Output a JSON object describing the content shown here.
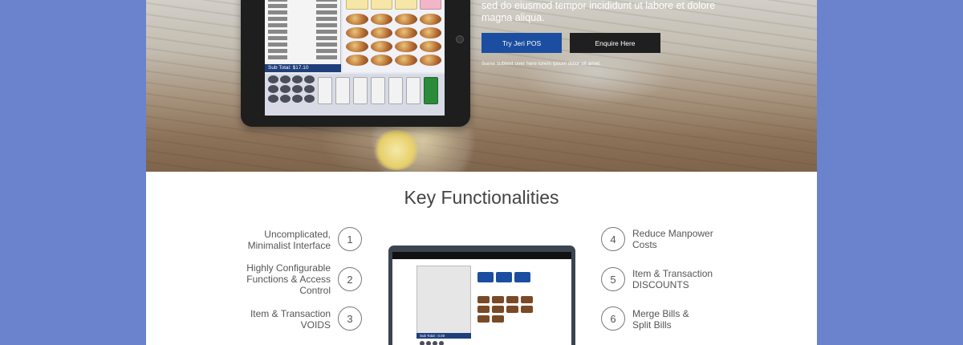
{
  "hero": {
    "text_line1": "sed do eiusmod tempor incididunt ut labore et dolore",
    "text_line2": "magna aliqua.",
    "try_button": "Try Jeri POS",
    "enquire_button": "Enquire Here",
    "subtext": "Some subtext over here lorem ipsum dolor sit amet."
  },
  "tablet": {
    "subtotal": "Sub Total: $17.10"
  },
  "features": {
    "title": "Key Functionalities",
    "items": [
      {
        "num": "1",
        "line1": "Uncomplicated,",
        "line2": "Minimalist Interface",
        "line3": ""
      },
      {
        "num": "2",
        "line1": "Highly Configurable",
        "line2": "Functions & Access",
        "line3": "Control"
      },
      {
        "num": "3",
        "line1": "Item & Transaction",
        "line2": "VOIDS",
        "line3": ""
      },
      {
        "num": "4",
        "line1": "Reduce Manpower",
        "line2": "Costs",
        "line3": ""
      },
      {
        "num": "5",
        "line1": "Item & Transaction",
        "line2": "DISCOUNTS",
        "line3": ""
      },
      {
        "num": "6",
        "line1": "Merge Bills &",
        "line2": "Split Bills",
        "line3": ""
      }
    ]
  },
  "laptop": {
    "subtotal": "Sub Total : 0.00"
  },
  "colors": {
    "background": "#6a83cc",
    "primary_button": "#1b4ea0",
    "secondary_button": "#1f1f1f",
    "pos_header": "#1f3f7a"
  }
}
